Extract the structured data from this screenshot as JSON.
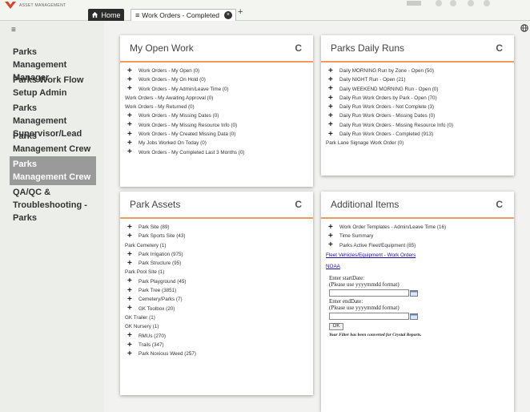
{
  "app": {
    "logo_text": "ASSET MANAGEMENT"
  },
  "tabs": {
    "home": "Home",
    "active": "Work Orders - Completed",
    "add": "+"
  },
  "sidebar": {
    "menu_icon": "≡",
    "items": [
      {
        "label": "Parks Management Manager"
      },
      {
        "label": "Parks Work Flow Setup Admin"
      },
      {
        "label": "Parks Management Supervisor/Lead"
      },
      {
        "label": "Parks Management Crew - Inspections"
      },
      {
        "label": "Parks Management Crew"
      },
      {
        "label": "QA/QC & Troubleshooting - Parks"
      }
    ],
    "active_index": 4
  },
  "panels": {
    "my_open_work": {
      "title": "My Open Work",
      "refresh_icon": "C",
      "rows": [
        {
          "text": "Work Orders - My Open (0)",
          "expandable": true
        },
        {
          "text": "Work Orders - My On Hold (0)",
          "expandable": true
        },
        {
          "text": "Work Orders - My Admin/Leave Time (0)",
          "expandable": true
        },
        {
          "text": "Work Orders - My Awaiting Approval (0)",
          "expandable": false
        },
        {
          "text": "Work Orders - My Returned (0)",
          "expandable": false
        },
        {
          "text": "Work Orders - My Missing Dates (0)",
          "expandable": true
        },
        {
          "text": "Work Orders - My Missing Resource Info (0)",
          "expandable": true
        },
        {
          "text": "Work Orders - My Created Missing Data (0)",
          "expandable": true
        },
        {
          "text": "My Jobs Worked On Today (0)",
          "expandable": true
        },
        {
          "text": "Work Orders - My Completed Last 3 Months (0)",
          "expandable": true
        }
      ]
    },
    "parks_daily_runs": {
      "title": "Parks Daily Runs",
      "refresh_icon": "C",
      "rows": [
        {
          "text": "Daily MORNING Run by Zone - Open (50)",
          "expandable": true
        },
        {
          "text": "Daily NIGHT Run - Open (21)",
          "expandable": true
        },
        {
          "text": "Daily WEEKEND MORNING Run - Open (0)",
          "expandable": true
        },
        {
          "text": "Daily Run Work Orders by Park - Open (70)",
          "expandable": true
        },
        {
          "text": "Daily Run Work Orders - Not Complete (3)",
          "expandable": true
        },
        {
          "text": "Daily Run Work Orders - Missing Dates (0)",
          "expandable": true
        },
        {
          "text": "Daily Run Work Orders - Missing Resource Info (0)",
          "expandable": true
        },
        {
          "text": "Daily Run Work Orders - Completed (913)",
          "expandable": true
        },
        {
          "text": "Park Lane Signage Work Order (0)",
          "expandable": false
        }
      ]
    },
    "park_assets": {
      "title": "Park Assets",
      "refresh_icon": "C",
      "rows": [
        {
          "text": "Park Site (89)",
          "expandable": true
        },
        {
          "text": "Park Sports Site (43)",
          "expandable": true
        },
        {
          "text": "Park Cemetery (1)",
          "expandable": false
        },
        {
          "text": "Park Irrigation (975)",
          "expandable": true
        },
        {
          "text": "Park Structure (95)",
          "expandable": true
        },
        {
          "text": "Park Pool Site (1)",
          "expandable": false
        },
        {
          "text": "Park Playground (45)",
          "expandable": true
        },
        {
          "text": "Park Tree (3851)",
          "expandable": true
        },
        {
          "text": "Cemetery/Parks (7)",
          "expandable": true
        },
        {
          "text": "GK Toolbox (20)",
          "expandable": true
        },
        {
          "text": "GK Trailer (1)",
          "expandable": false
        },
        {
          "text": "GK Nursery (1)",
          "expandable": false
        },
        {
          "text": "RMUs (270)",
          "expandable": true
        },
        {
          "text": "Trails (347)",
          "expandable": true
        },
        {
          "text": "Park Noxious Weed (257)",
          "expandable": true
        }
      ]
    },
    "additional_items": {
      "title": "Additional Items",
      "refresh_icon": "C",
      "rows": [
        {
          "text": "Work Order Templates - Admin/Leave Time (16)",
          "expandable": true
        },
        {
          "text": "Time Summary",
          "expandable": true
        },
        {
          "text": "Parks Active Fleet/Equipment (85)",
          "expandable": true
        }
      ],
      "links": [
        "Fleet Vehicles/Equipment - Work Orders",
        "NOAA"
      ],
      "form": {
        "start_label_1": "Enter startDate:",
        "start_label_2": "(Please use yyyymmdd format)",
        "end_label_1": "Enter endDate:",
        "end_label_2": "(Please use yyyymmdd format)",
        "start_value": "",
        "end_value": "",
        "ok_label": "OK",
        "note": "Your Filter has been converted for Crystal Reports."
      }
    }
  },
  "colors": {
    "accent": "#f39a60",
    "active_item": "#9a9a9a",
    "dark_tab": "#2b2b2b",
    "link": "#1a0dab"
  }
}
